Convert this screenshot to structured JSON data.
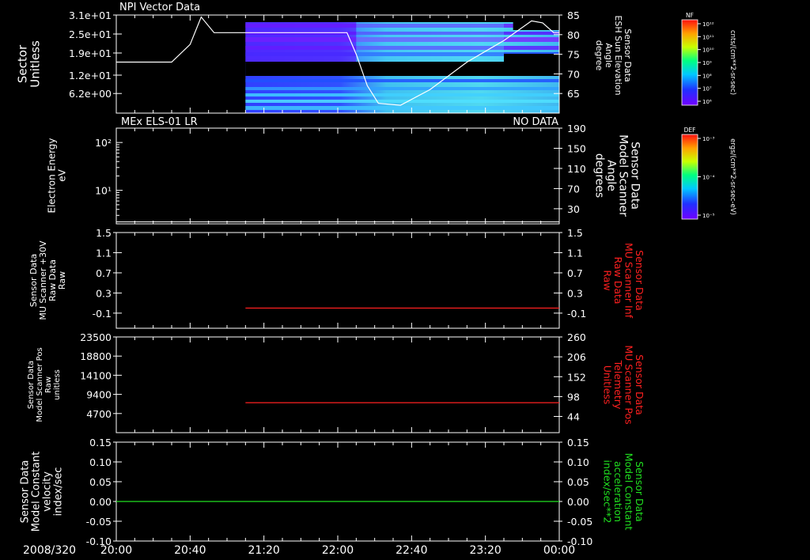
{
  "colors": {
    "background": "#000000",
    "axis": "#ffffff",
    "red_trace": "#ff2020",
    "green_trace": "#20e020",
    "label_red": "#ff2020",
    "label_green": "#20e020"
  },
  "time_axis": {
    "date_label": "2008/320",
    "ticks": [
      "20:00",
      "20:40",
      "21:20",
      "22:00",
      "22:40",
      "23:20",
      "00:00"
    ],
    "start_hours": 20,
    "end_hours": 24
  },
  "colorbars": [
    {
      "name": "NF",
      "title": "NF",
      "unit_label": "cnts/(cm**2-sr-sec)",
      "tick_labels": [
        "10¹²",
        "10¹¹",
        "10¹⁰",
        "10⁹",
        "10⁸",
        "10⁷",
        "10⁶"
      ]
    },
    {
      "name": "DEF",
      "title": "DEF",
      "unit_label": "ergs/(cm**2-sr-sec-eV)",
      "tick_labels": [
        "10⁻³",
        "10⁻⁴",
        "10⁻⁵"
      ]
    }
  ],
  "chart_data": [
    {
      "type": "heatmap",
      "title": "NPI Vector Data",
      "left_axis": {
        "label_lines": [
          "Sector",
          "Unitless"
        ],
        "tick_labels": [
          "3.1e+01",
          "2.5e+01",
          "1.9e+01",
          "1.2e+01",
          "6.2e+00"
        ],
        "tick_values": [
          31,
          25,
          19,
          12,
          6.2
        ],
        "range": [
          0,
          31
        ]
      },
      "right_axis": {
        "label_lines": [
          "Sensor Data",
          "ESH Sun Elevation",
          "Angle",
          "degree"
        ],
        "tick_labels": [
          "85",
          "80",
          "75",
          "70",
          "65"
        ],
        "tick_values": [
          85,
          80,
          75,
          70,
          65
        ],
        "range": [
          60,
          85
        ],
        "label_color": "#ffffff"
      },
      "heatmap_start_time": "21:10",
      "line_series": {
        "axis": "right",
        "color": "#ffffff",
        "x": [
          "20:00",
          "20:30",
          "20:40",
          "20:46",
          "20:53",
          "21:10",
          "21:40",
          "22:05",
          "22:10",
          "22:16",
          "22:22",
          "22:34",
          "22:50",
          "23:10",
          "23:30",
          "23:45",
          "23:51",
          "23:57",
          "24:00"
        ],
        "y": [
          73,
          73,
          77.5,
          84.5,
          80.5,
          80.5,
          80.5,
          80.5,
          75,
          67,
          62.5,
          62,
          66,
          73,
          78.5,
          83.5,
          83,
          80.5,
          80.5
        ]
      }
    },
    {
      "type": "line",
      "title": "MEx ELS-01 LR",
      "status_label": "NO DATA",
      "left_axis": {
        "label_lines": [
          "Electron Energy",
          "eV"
        ],
        "tick_labels": [
          "10²",
          "10¹"
        ],
        "log_decades": [
          2,
          1
        ],
        "range_log": [
          0.3,
          2.3
        ]
      },
      "right_axis": {
        "label_lines": [
          "Sensor Data",
          "Model Scanner",
          "Angle",
          "degrees"
        ],
        "tick_labels": [
          "190",
          "150",
          "110",
          "70",
          "30"
        ],
        "tick_values": [
          190,
          150,
          110,
          70,
          30
        ],
        "range": [
          0,
          190
        ],
        "label_color": "#ffffff"
      },
      "series": [
        {
          "axis": "right",
          "color": "#ffffff",
          "x": [
            "20:00",
            "24:00"
          ],
          "y": [
            4,
            4
          ]
        }
      ]
    },
    {
      "type": "line",
      "left_axis": {
        "label_lines": [
          "Sensor Data",
          "MU Scanner +30V",
          "Raw Data",
          "Raw"
        ],
        "tick_labels": [
          "1.5",
          "1.1",
          "0.7",
          "0.3",
          "-0.1"
        ],
        "tick_values": [
          1.5,
          1.1,
          0.7,
          0.3,
          -0.1
        ],
        "range": [
          -0.4,
          1.5
        ]
      },
      "right_axis": {
        "label_lines": [
          "Sensor Data",
          "MU Scanner Inf",
          "Raw Data",
          "Raw"
        ],
        "tick_labels": [
          "1.5",
          "1.1",
          "0.7",
          "0.3",
          "-0.1"
        ],
        "tick_values": [
          1.5,
          1.1,
          0.7,
          0.3,
          -0.1
        ],
        "range": [
          -0.4,
          1.5
        ],
        "label_color": "#ff2020"
      },
      "series": [
        {
          "axis": "left",
          "color": "#ff2020",
          "x": [
            "21:10",
            "24:00"
          ],
          "y": [
            0.0,
            0.0
          ]
        }
      ]
    },
    {
      "type": "line",
      "left_axis": {
        "label_lines": [
          "Sensor Data",
          "Model Scanner Pos",
          "Raw",
          "unitless"
        ],
        "tick_labels": [
          "23500",
          "18800",
          "14100",
          "9400",
          "4700"
        ],
        "tick_values": [
          23500,
          18800,
          14100,
          9400,
          4700
        ],
        "range": [
          0,
          23500
        ]
      },
      "right_axis": {
        "label_lines": [
          "Sensor Data",
          "MU Scanner Pos",
          "Telemetry",
          "Unitless"
        ],
        "tick_labels": [
          "260",
          "206",
          "152",
          "98",
          "44"
        ],
        "tick_values": [
          260,
          206,
          152,
          98,
          44
        ],
        "range": [
          0,
          260
        ],
        "label_color": "#ff2020"
      },
      "series": [
        {
          "axis": "left",
          "color": "#ff2020",
          "x": [
            "21:10",
            "24:00"
          ],
          "y": [
            7350,
            7350
          ]
        }
      ]
    },
    {
      "type": "line",
      "left_axis": {
        "label_lines": [
          "Sensor Data",
          "Model Constant",
          "velocity",
          "index/sec"
        ],
        "tick_labels": [
          "0.15",
          "0.10",
          "0.05",
          "0.00",
          "-0.05",
          "-0.10"
        ],
        "tick_values": [
          0.15,
          0.1,
          0.05,
          0.0,
          -0.05,
          -0.1
        ],
        "range": [
          -0.1,
          0.15
        ]
      },
      "right_axis": {
        "label_lines": [
          "Sensor Data",
          "Model Constant",
          "acceleration",
          "index/sec**2"
        ],
        "tick_labels": [
          "0.15",
          "0.10",
          "0.05",
          "0.00",
          "-0.05",
          "-0.10"
        ],
        "tick_values": [
          0.15,
          0.1,
          0.05,
          0.0,
          -0.05,
          -0.1
        ],
        "range": [
          -0.1,
          0.15
        ],
        "label_color": "#20e020"
      },
      "series": [
        {
          "axis": "left",
          "color": "#20e020",
          "x": [
            "20:00",
            "24:00"
          ],
          "y": [
            0.0,
            0.0
          ]
        }
      ]
    }
  ]
}
